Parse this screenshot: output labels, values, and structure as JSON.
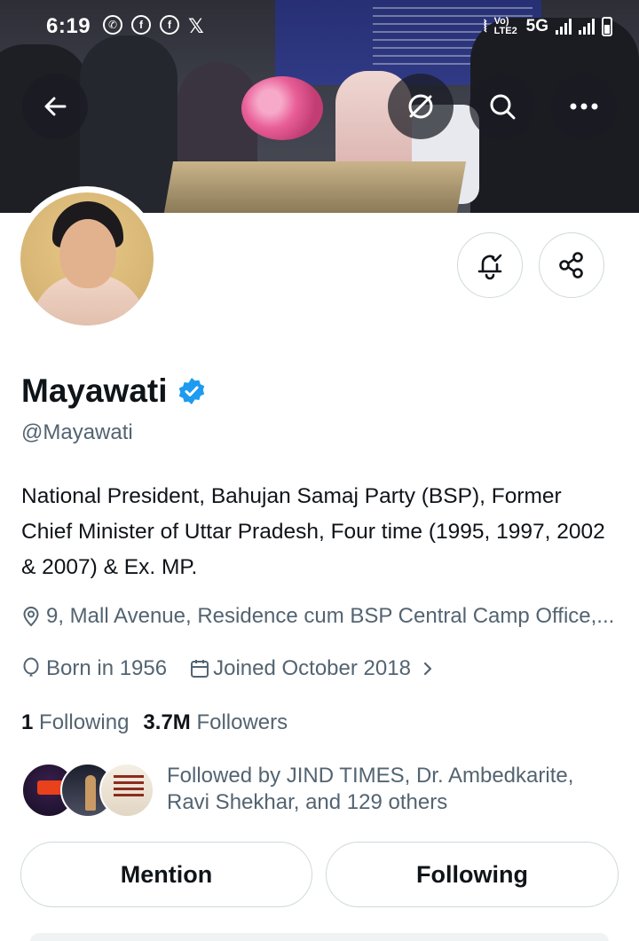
{
  "status_bar": {
    "time": "6:19",
    "network": "5G",
    "volte": "Vo) LTE2",
    "app_icons": [
      "whatsapp-icon",
      "facebook-icon",
      "facebook-icon",
      "x-icon"
    ]
  },
  "nav": {
    "back_icon": "back-arrow-icon",
    "grok_icon": "grok-icon",
    "search_icon": "search-icon",
    "more_icon": "more-icon"
  },
  "profile": {
    "name": "Mayawati",
    "handle": "@Mayawati",
    "verified": true,
    "bio": "National President, Bahujan Samaj Party (BSP), Former Chief Minister of Uttar Pradesh, Four time (1995, 1997, 2002 & 2007) & Ex. MP.",
    "location": "9, Mall Avenue, Residence cum BSP Central Camp Office,...",
    "born": "Born in 1956",
    "joined": "Joined October 2018",
    "following_count": "1",
    "following_label": "Following",
    "followers_count": "3.7M",
    "followers_label": "Followers",
    "followed_by": "Followed by JIND TIMES, Dr. Ambedkarite, Ravi Shekhar, and 129 others"
  },
  "actions": {
    "mention_label": "Mention",
    "following_button_label": "Following"
  },
  "colors": {
    "verified_blue": "#1d9bf0",
    "secondary_text": "#536471",
    "border": "#cfd9de"
  }
}
